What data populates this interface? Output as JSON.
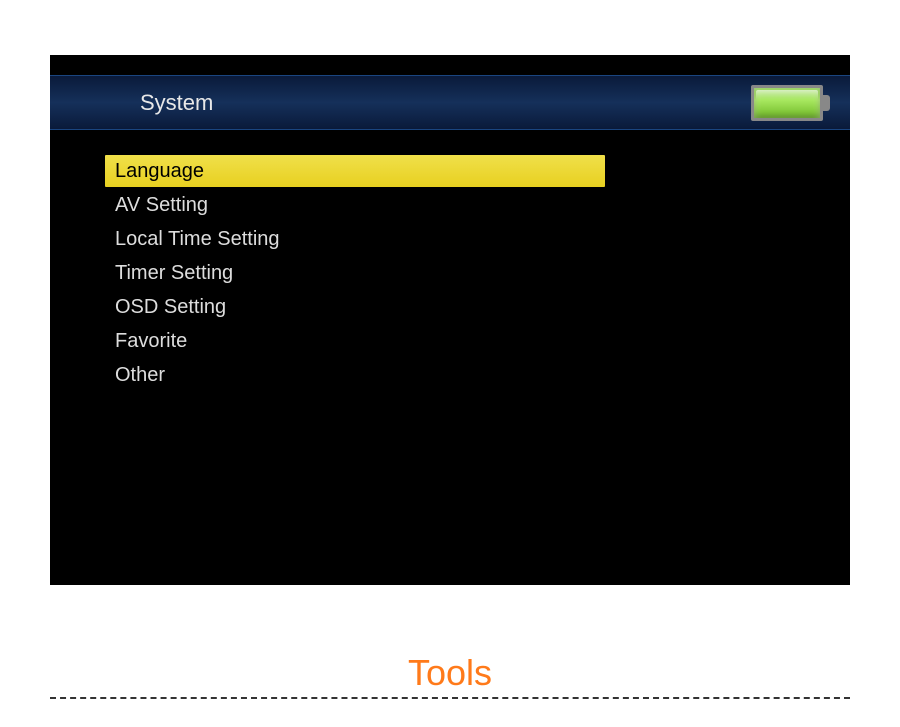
{
  "header": {
    "title": "System"
  },
  "menu": {
    "items": [
      {
        "label": "Language",
        "selected": true
      },
      {
        "label": "AV Setting",
        "selected": false
      },
      {
        "label": "Local Time Setting",
        "selected": false
      },
      {
        "label": "Timer Setting",
        "selected": false
      },
      {
        "label": "OSD Setting",
        "selected": false
      },
      {
        "label": "Favorite",
        "selected": false
      },
      {
        "label": "Other",
        "selected": false
      }
    ]
  },
  "bottom": {
    "label": "Tools"
  }
}
